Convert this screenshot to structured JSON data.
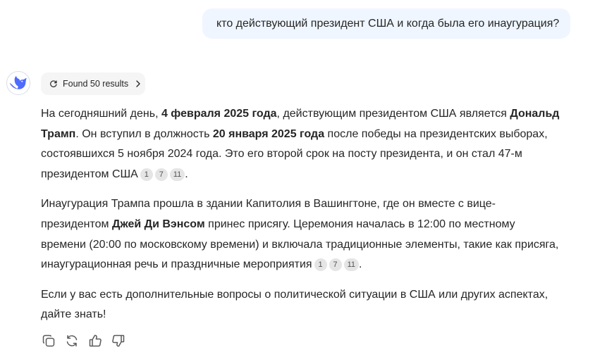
{
  "user_message": "кто действующий президент США и когда была его инаугурация?",
  "search": {
    "label": "Found 50 results"
  },
  "answer": {
    "p1": {
      "t1": "На сегодняшний день, ",
      "b1": "4 февраля 2025 года",
      "t2": ", действующим президентом США является ",
      "b2": "Дональд Трамп",
      "t3": ". Он вступил в должность ",
      "b3": "20 января 2025 года",
      "t4": " после победы на президентских выборах, состоявшихся 5 ноября 2024 года. Это его второй срок на посту президента, и он стал 47-м президентом США",
      "cites": [
        "1",
        "7",
        "11"
      ],
      "end": "."
    },
    "p2": {
      "t1": "Инаугурация Трампа прошла в здании Капитолия в Вашингтоне, где он вместе с вице-президентом ",
      "b1": "Джей Ди Вэнсом",
      "t2": " принес присягу. Церемония началась в 12:00 по местному времени (20:00 по московскому времени) и включала традиционные элементы, такие как присяга, инаугурационная речь и праздничные мероприятия",
      "cites": [
        "1",
        "7",
        "11"
      ],
      "end": "."
    },
    "p3": {
      "t1": "Если у вас есть дополнительные вопросы о политической ситуации в США или других аспектах, дайте знать!"
    }
  },
  "actions": [
    "copy-icon",
    "regenerate-icon",
    "thumbs-up-icon",
    "thumbs-down-icon"
  ],
  "colors": {
    "accent": "#4d6bfe",
    "bubble": "#eff6ff",
    "chip": "#f5f5f5",
    "text": "#262626"
  }
}
